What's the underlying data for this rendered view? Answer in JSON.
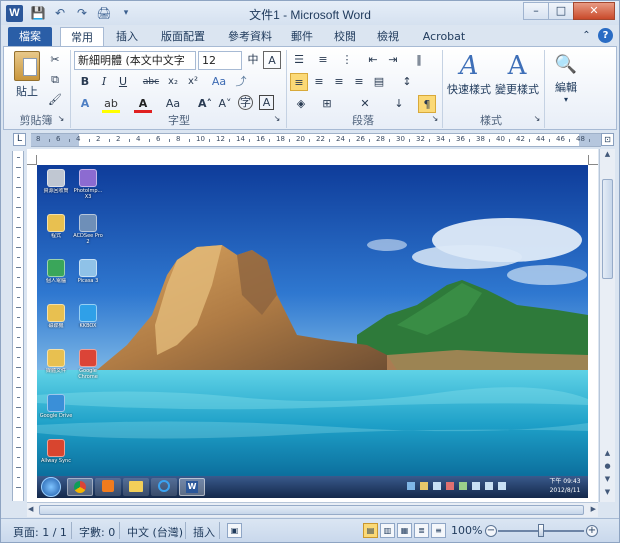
{
  "window": {
    "title": "文件1 - Microsoft Word",
    "app_icon": "W",
    "qat_icons": [
      "save-icon",
      "undo-icon",
      "redo-icon",
      "print-preview-icon",
      "customize-qat-icon"
    ]
  },
  "tabs": [
    {
      "label": "檔案"
    },
    {
      "label": "常用"
    },
    {
      "label": "插入"
    },
    {
      "label": "版面配置"
    },
    {
      "label": "參考資料"
    },
    {
      "label": "郵件"
    },
    {
      "label": "校閱"
    },
    {
      "label": "檢視"
    },
    {
      "label": "Acrobat"
    }
  ],
  "ribbon": {
    "clipboard": {
      "label": "剪貼簿",
      "paste": "貼上"
    },
    "font": {
      "label": "字型",
      "font_name": "新細明體 (本文中文字",
      "font_size": "12"
    },
    "paragraph": {
      "label": "段落"
    },
    "styles": {
      "label": "樣式",
      "quick_styles": "快速樣式",
      "change_styles": "變更樣式"
    },
    "editing": {
      "label": "編輯"
    }
  },
  "ruler": {
    "numbers": [
      "8",
      "6",
      "4",
      "2",
      "2",
      "4",
      "6",
      "8",
      "10",
      "12",
      "14",
      "16",
      "18",
      "20",
      "22",
      "24",
      "26",
      "28",
      "30",
      "32",
      "34",
      "36",
      "38",
      "40",
      "42",
      "44",
      "46",
      "48"
    ]
  },
  "desktop_icons": [
    {
      "label": "資源回收筒"
    },
    {
      "label": "PhotoImp... X3"
    },
    {
      "label": "程式"
    },
    {
      "label": "ACDSee Pro 2"
    },
    {
      "label": "個人電腦"
    },
    {
      "label": "Picasa 3"
    },
    {
      "label": "磁碟機"
    },
    {
      "label": "KKBOX"
    },
    {
      "label": "媒體文件"
    },
    {
      "label": "Google Chrome"
    },
    {
      "label": "Google Drive"
    },
    {
      "label": "Allway Sync"
    }
  ],
  "taskbar": {
    "time": "下午 09:43",
    "date": "2012/8/11"
  },
  "status": {
    "page": "頁面: 1 / 1",
    "words": "字數: 0",
    "language": "中文 (台灣)",
    "mode": "插入",
    "zoom": "100%",
    "zoom_value": 100
  },
  "colors": {
    "file_tab": "#2a5ea7",
    "sea": "#1ea0c8",
    "sky": "#1d58b5"
  }
}
